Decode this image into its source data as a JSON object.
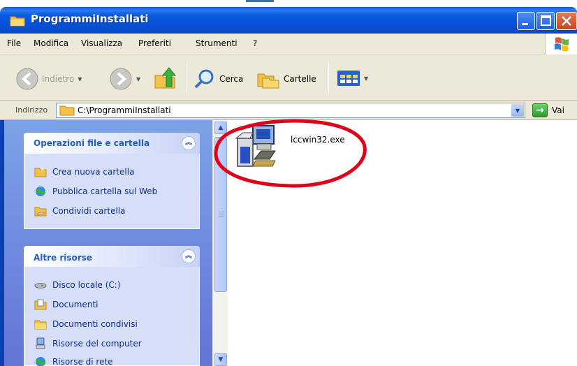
{
  "window": {
    "title": "ProgrammiInstallati"
  },
  "menu": [
    "File",
    "Modifica",
    "Visualizza",
    "Preferiti",
    "Strumenti",
    "?"
  ],
  "toolbar": {
    "back": "Indietro",
    "search": "Cerca",
    "folders": "Cartelle"
  },
  "address": {
    "label": "Indirizzo",
    "path": "C:\\ProgrammiInstallati",
    "go": "Vai"
  },
  "tasks_panel": {
    "title": "Operazioni file e cartella",
    "items": [
      {
        "label": "Crea nuova cartella",
        "icon": "new-folder-icon"
      },
      {
        "label": "Pubblica cartella sul Web",
        "icon": "publish-web-icon"
      },
      {
        "label": "Condividi cartella",
        "icon": "share-folder-icon"
      }
    ]
  },
  "places_panel": {
    "title": "Altre risorse",
    "items": [
      {
        "label": "Disco locale (C:)",
        "icon": "local-disk-icon"
      },
      {
        "label": "Documenti",
        "icon": "documents-icon"
      },
      {
        "label": "Documenti condivisi",
        "icon": "shared-documents-icon"
      },
      {
        "label": "Risorse del computer",
        "icon": "my-computer-icon"
      },
      {
        "label": "Risorse di rete",
        "icon": "network-icon"
      }
    ]
  },
  "files": [
    {
      "name": "lccwin32.exe",
      "icon": "installer-icon"
    }
  ],
  "colors": {
    "titlebar": "#0650d8",
    "task_pane": "#7ba2e7",
    "panel_title": "#215dc6",
    "highlight_circle": "#e0001a"
  }
}
